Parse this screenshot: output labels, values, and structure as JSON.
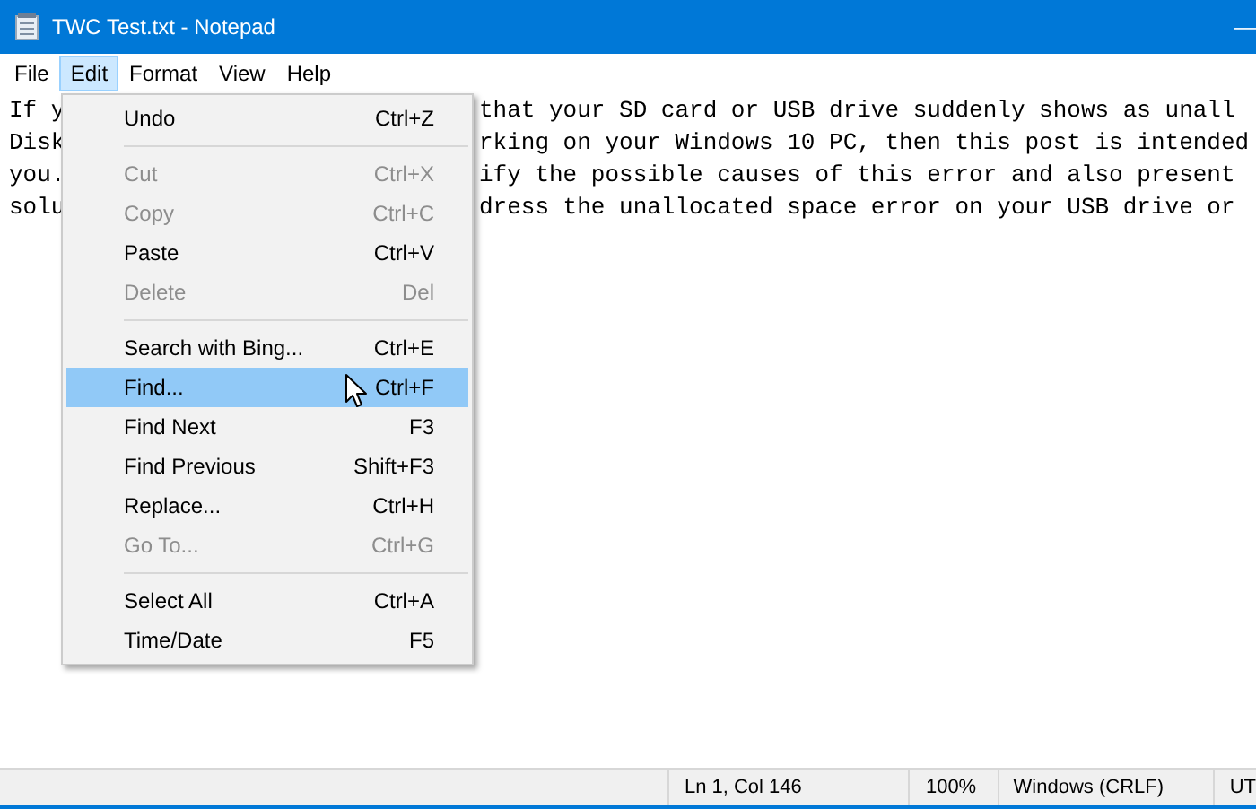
{
  "window": {
    "title": "TWC Test.txt - Notepad",
    "minimize": "—"
  },
  "menubar": [
    {
      "label": "File",
      "selected": false
    },
    {
      "label": "Edit",
      "selected": true
    },
    {
      "label": "Format",
      "selected": false
    },
    {
      "label": "View",
      "selected": false
    },
    {
      "label": "Help",
      "selected": false
    }
  ],
  "document": {
    "lines": [
      {
        "left": "If y",
        "right": "that your SD card or USB drive suddenly shows as unall"
      },
      {
        "left": "Disk",
        "right": "rking on your Windows 10 PC, then this post is intended"
      },
      {
        "left": "you.",
        "right": "ify the possible causes of this error and also present"
      },
      {
        "left": "solu",
        "right": "dress the unallocated space error on your USB drive or"
      }
    ]
  },
  "edit_menu": [
    {
      "kind": "item",
      "label": "Undo",
      "shortcut": "Ctrl+Z",
      "disabled": false,
      "selected": false
    },
    {
      "kind": "separator"
    },
    {
      "kind": "item",
      "label": "Cut",
      "shortcut": "Ctrl+X",
      "disabled": true,
      "selected": false
    },
    {
      "kind": "item",
      "label": "Copy",
      "shortcut": "Ctrl+C",
      "disabled": true,
      "selected": false
    },
    {
      "kind": "item",
      "label": "Paste",
      "shortcut": "Ctrl+V",
      "disabled": false,
      "selected": false
    },
    {
      "kind": "item",
      "label": "Delete",
      "shortcut": "Del",
      "disabled": true,
      "selected": false
    },
    {
      "kind": "separator"
    },
    {
      "kind": "item",
      "label": "Search with Bing...",
      "shortcut": "Ctrl+E",
      "disabled": false,
      "selected": false
    },
    {
      "kind": "item",
      "label": "Find...",
      "shortcut": "Ctrl+F",
      "disabled": false,
      "selected": true
    },
    {
      "kind": "item",
      "label": "Find Next",
      "shortcut": "F3",
      "disabled": false,
      "selected": false
    },
    {
      "kind": "item",
      "label": "Find Previous",
      "shortcut": "Shift+F3",
      "disabled": false,
      "selected": false
    },
    {
      "kind": "item",
      "label": "Replace...",
      "shortcut": "Ctrl+H",
      "disabled": false,
      "selected": false
    },
    {
      "kind": "item",
      "label": "Go To...",
      "shortcut": "Ctrl+G",
      "disabled": true,
      "selected": false
    },
    {
      "kind": "separator"
    },
    {
      "kind": "item",
      "label": "Select All",
      "shortcut": "Ctrl+A",
      "disabled": false,
      "selected": false
    },
    {
      "kind": "item",
      "label": "Time/Date",
      "shortcut": "F5",
      "disabled": false,
      "selected": false
    }
  ],
  "status_bar": {
    "position": "Ln 1, Col 146",
    "zoom": "100%",
    "line_ending": "Windows (CRLF)",
    "encoding": "UT"
  }
}
